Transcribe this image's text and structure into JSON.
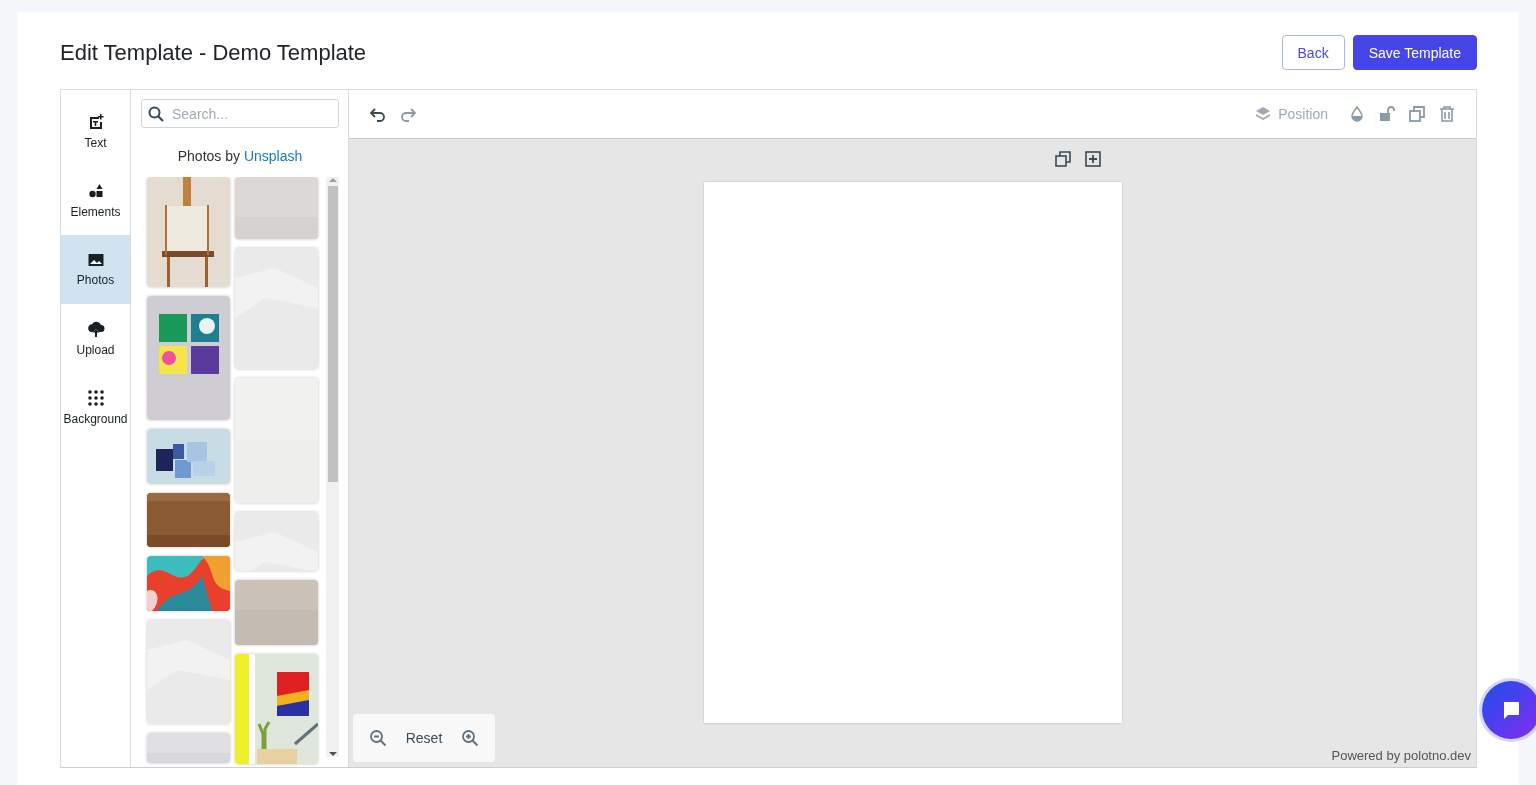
{
  "header": {
    "title": "Edit Template - Demo Template",
    "buttons": [
      {
        "label": "Back",
        "kind": "outline"
      },
      {
        "label": "Save Template",
        "kind": "primary"
      }
    ]
  },
  "sidebar": {
    "items": [
      {
        "label": "Text",
        "selected": false
      },
      {
        "label": "Elements",
        "selected": false
      },
      {
        "label": "Photos",
        "selected": true
      },
      {
        "label": "Upload",
        "selected": false
      },
      {
        "label": "Background",
        "selected": false
      }
    ]
  },
  "panel": {
    "search": {
      "placeholder": "Search..."
    },
    "credit_prefix": "Photos by",
    "credit_link": "Unsplash"
  },
  "toolbar": {
    "position_label": "Position"
  },
  "zoom": {
    "reset_label": "Reset"
  },
  "footer": {
    "powered_by": "Powered by polotno.dev"
  }
}
